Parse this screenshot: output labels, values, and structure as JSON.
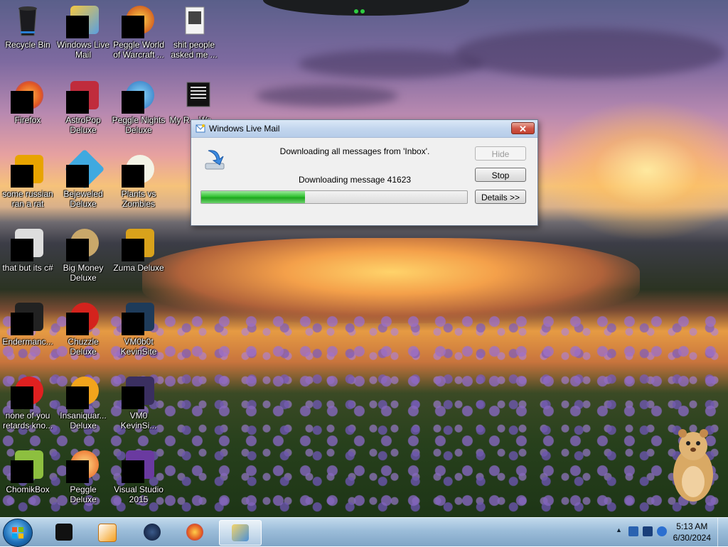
{
  "desktop": {
    "icons": [
      {
        "label": "Recycle Bin"
      },
      {
        "label": "Windows Live Mail"
      },
      {
        "label": "Peggle World of Warcraft ..."
      },
      {
        "label": "shit people asked me ..."
      },
      {
        "label": "Firefox"
      },
      {
        "label": "AstroPop Deluxe"
      },
      {
        "label": "Peggle Nights Deluxe"
      },
      {
        "label": "My R... Wa..."
      },
      {
        "label": "some russian ran a rat"
      },
      {
        "label": "Bejeweled Deluxe"
      },
      {
        "label": "Plants vs Zombies"
      },
      {
        "label": "that but its c#"
      },
      {
        "label": "Big Money Deluxe"
      },
      {
        "label": "Zuma Deluxe"
      },
      {
        "label": "Endermanc..."
      },
      {
        "label": "Chuzzle Deluxe"
      },
      {
        "label": "VM0b0t KevinSite"
      },
      {
        "label": "none of you retards kno..."
      },
      {
        "label": "Insaniquar... Deluxe"
      },
      {
        "label": "VM0 KevinSi..."
      },
      {
        "label": "ChomikBox"
      },
      {
        "label": "Peggle Deluxe"
      },
      {
        "label": "Visual Studio 2015"
      }
    ]
  },
  "dialog": {
    "title": "Windows Live Mail",
    "close_label": "✕",
    "message_primary": "Downloading all messages from 'Inbox'.",
    "message_secondary": "Downloading message 41623",
    "progress_fraction": 0.39,
    "buttons": {
      "hide": "Hide",
      "stop": "Stop",
      "details": "Details >>"
    }
  },
  "taskbar": {
    "pinned": [
      {
        "name": "black-box-app"
      },
      {
        "name": "media-player"
      },
      {
        "name": "dark-globe-app"
      },
      {
        "name": "firefox"
      },
      {
        "name": "windows-live-mail",
        "active": true
      }
    ],
    "clock": {
      "time": "5:13 AM",
      "date": "6/30/2024"
    },
    "tray_arrow": "▲"
  },
  "colors": {
    "progress_fill": "#22b422",
    "close_button": "#c9493a",
    "taskbar": "#9dbbd8"
  }
}
